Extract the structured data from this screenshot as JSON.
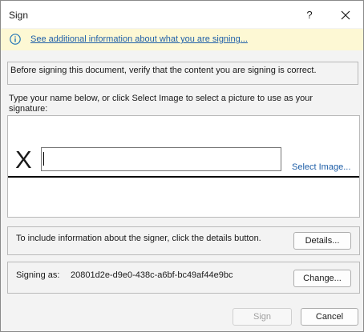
{
  "window": {
    "title": "Sign",
    "help_label": "?"
  },
  "infobar": {
    "link_text": "See additional information about what you are signing..."
  },
  "verify_text": "Before signing this document, verify that the content you are signing is correct.",
  "instruction_text": "Type your name below, or click Select Image to select a picture to use as your signature:",
  "signature": {
    "x_mark": "X",
    "name_value": "",
    "select_image_label": "Select Image..."
  },
  "details": {
    "text": "To include information about the signer, click the details button.",
    "button_label": "Details..."
  },
  "signing_as": {
    "label": "Signing as:",
    "value": "20801d2e-d9e0-438c-a6bf-bc49af44e9bc",
    "button_label": "Change..."
  },
  "footer": {
    "sign_label": "Sign",
    "cancel_label": "Cancel"
  },
  "colors": {
    "link": "#1f5fa8",
    "infobar_bg": "#fdf8d4",
    "info_icon": "#1f73b7"
  }
}
